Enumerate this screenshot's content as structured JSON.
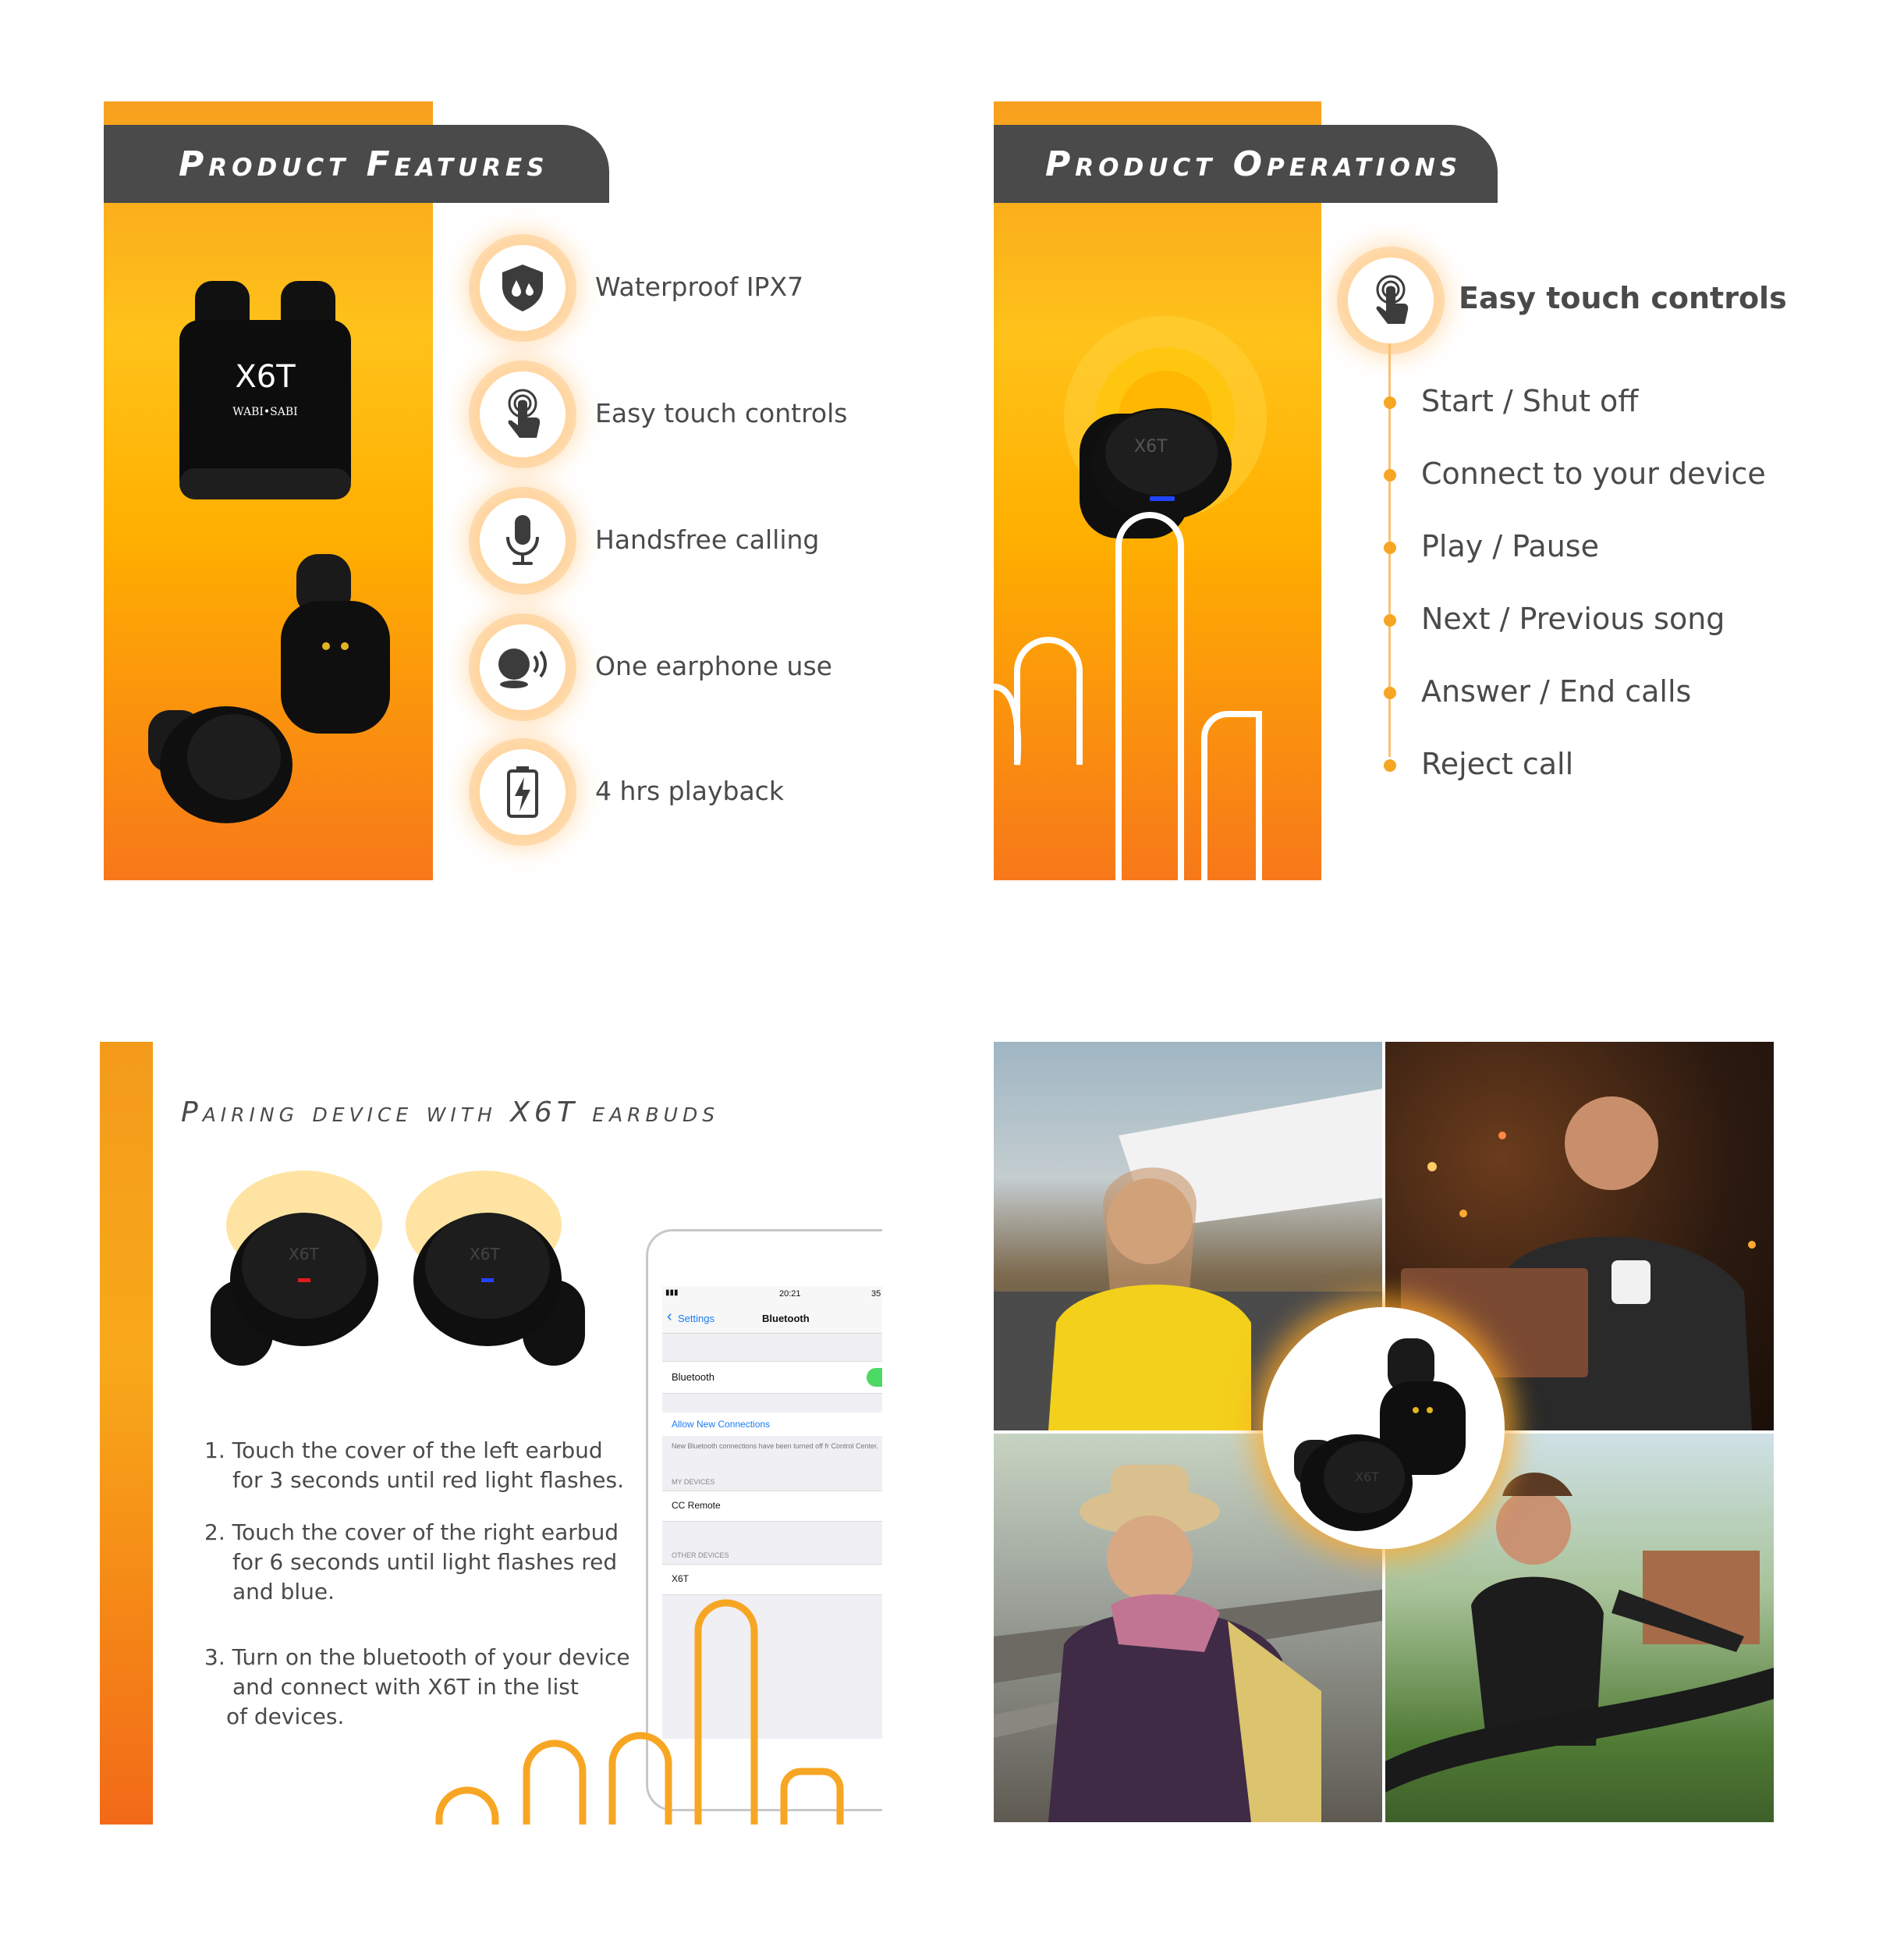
{
  "features": {
    "title": "Product Features",
    "items": [
      {
        "label": "Waterproof IPX7",
        "icon": "waterproof-shield-icon"
      },
      {
        "label": "Easy touch controls",
        "icon": "touch-finger-icon"
      },
      {
        "label": "Handsfree calling",
        "icon": "microphone-icon"
      },
      {
        "label": "One earphone use",
        "icon": "earphone-sound-icon"
      },
      {
        "label": "4 hrs playback",
        "icon": "battery-charge-icon"
      }
    ],
    "case": {
      "model": "X6T",
      "brand": "WABI•SABI"
    }
  },
  "operations": {
    "title": "Product Operations",
    "heading": "Easy touch controls",
    "heading_icon": "touch-finger-icon",
    "items": [
      "Start / Shut off",
      "Connect to your device",
      "Play / Pause",
      "Next / Previous song",
      "Answer / End calls",
      "Reject call"
    ],
    "earbud_label": "X6T"
  },
  "pairing": {
    "title": "Pairing device with X6T earbuds",
    "earbud_left_label": "X6T",
    "earbud_right_label": "X6T",
    "steps": [
      {
        "line1": "1. Touch the cover of the left earbud",
        "line2": "for 3 seconds until red light flashes.",
        "line3": ""
      },
      {
        "line1": "2. Touch the cover of the right earbud",
        "line2": "for 6 seconds until light flashes red",
        "line3": "and blue."
      },
      {
        "line1": "3. Turn on the bluetooth of your device",
        "line2": "and connect with X6T in the list",
        "line3": "of devices."
      }
    ],
    "phone": {
      "time": "20:21",
      "battery": "35",
      "back_label": "Settings",
      "screen_title": "Bluetooth",
      "bluetooth_label": "Bluetooth",
      "allow_label": "Allow New Connections",
      "note": "New Bluetooth connections have been turned off fr Control Center.",
      "my_devices_header": "MY DEVICES",
      "my_device": "CC Remote",
      "other_devices_header": "OTHER DEVICES",
      "other_device": "X6T"
    }
  },
  "lifestyle": {
    "earbud_label": "X6T"
  },
  "colors": {
    "accent_orange": "#f7a623",
    "header_gray": "#4a4a4a",
    "ios_blue": "#1a7cf5",
    "ios_green": "#4cd964"
  }
}
